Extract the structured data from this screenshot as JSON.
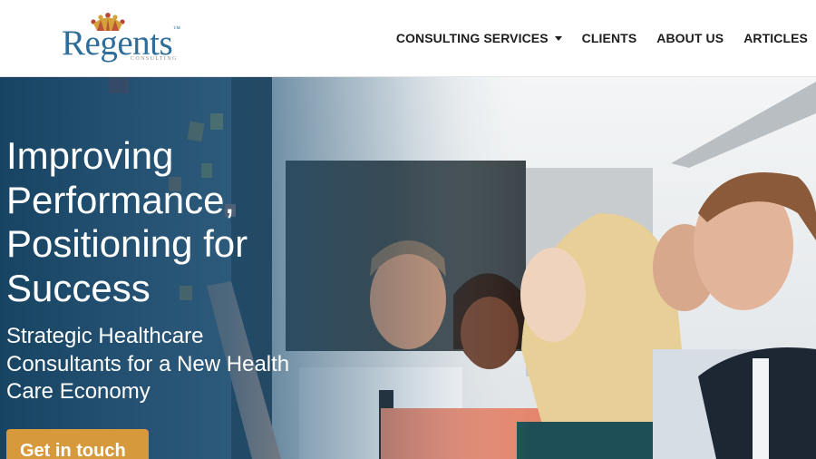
{
  "header": {
    "logo": {
      "name": "Regents",
      "tagline": "CONSULTING",
      "trademark": "™"
    },
    "nav": [
      {
        "label": "CONSULTING SERVICES",
        "has_dropdown": true
      },
      {
        "label": "CLIENTS",
        "has_dropdown": false
      },
      {
        "label": "ABOUT US",
        "has_dropdown": false
      },
      {
        "label": "ARTICLES",
        "has_dropdown": false
      }
    ]
  },
  "hero": {
    "title": "Improving Performance, Positioning for Success",
    "subtitle": "Strategic Healthcare Consultants for a New Health Care Economy",
    "cta_label": "Get in touch",
    "image": "team-meeting-photo"
  },
  "colors": {
    "logo_blue": "#2f6e9a",
    "crown_gold": "#d4a23a",
    "crown_red": "#b8443a",
    "cta_gold": "#d69a3c",
    "nav_text": "#1d1d1d",
    "overlay_blue": "#14466b"
  }
}
